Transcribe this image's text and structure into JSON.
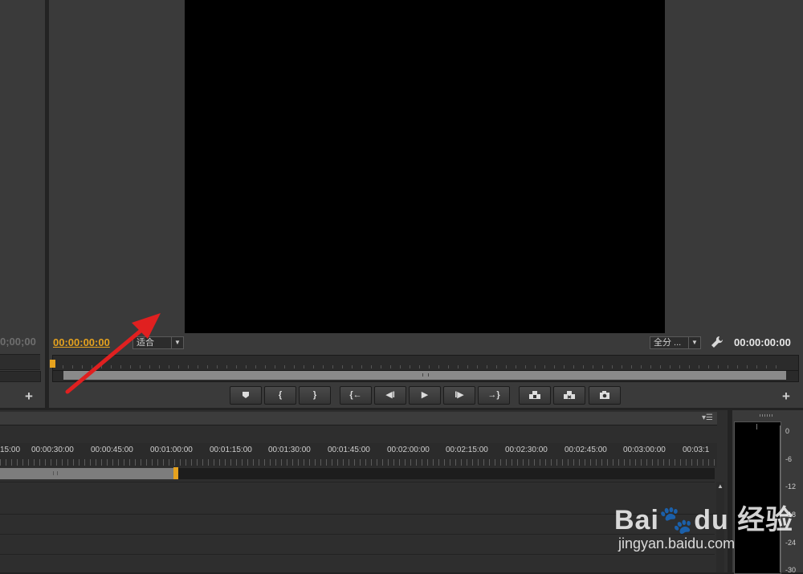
{
  "source_monitor": {
    "timecode": "0;00;00",
    "add_icon": "plus-icon"
  },
  "program_monitor": {
    "timecode_current": "00:00:00:00",
    "fit_select": "适合",
    "quality_select": "全分 ...",
    "settings_icon": "wrench-icon",
    "timecode_duration": "00:00:00:00",
    "add_icon": "plus-icon",
    "transport": {
      "marker": "marker-icon",
      "mark_in": "{",
      "mark_out": "}",
      "go_to_in": "{←",
      "step_back": "◀I",
      "play": "▶",
      "step_forward": "I▶",
      "go_to_out": "→}",
      "lift": "lift-icon",
      "extract": "extract-icon",
      "export_frame": "camera-icon"
    }
  },
  "timeline": {
    "timecodes": [
      "15:00",
      "00:00:30:00",
      "00:00:45:00",
      "00:01:00:00",
      "00:01:15:00",
      "00:01:30:00",
      "00:01:45:00",
      "00:02:00:00",
      "00:02:15:00",
      "00:02:30:00",
      "00:02:45:00",
      "00:03:00:00",
      "00:03:1"
    ],
    "menu_icon": "panel-menu-icon"
  },
  "audio_meter": {
    "labels": [
      "0",
      "-6",
      "-12",
      "-18",
      "-24",
      "-30"
    ]
  },
  "watermark": {
    "logo": "Bai🐾du 经验",
    "url": "jingyan.baidu.com"
  },
  "colors": {
    "accent": "#e6a21e",
    "panel": "#3a3a3a",
    "arrow": "#e02020"
  }
}
